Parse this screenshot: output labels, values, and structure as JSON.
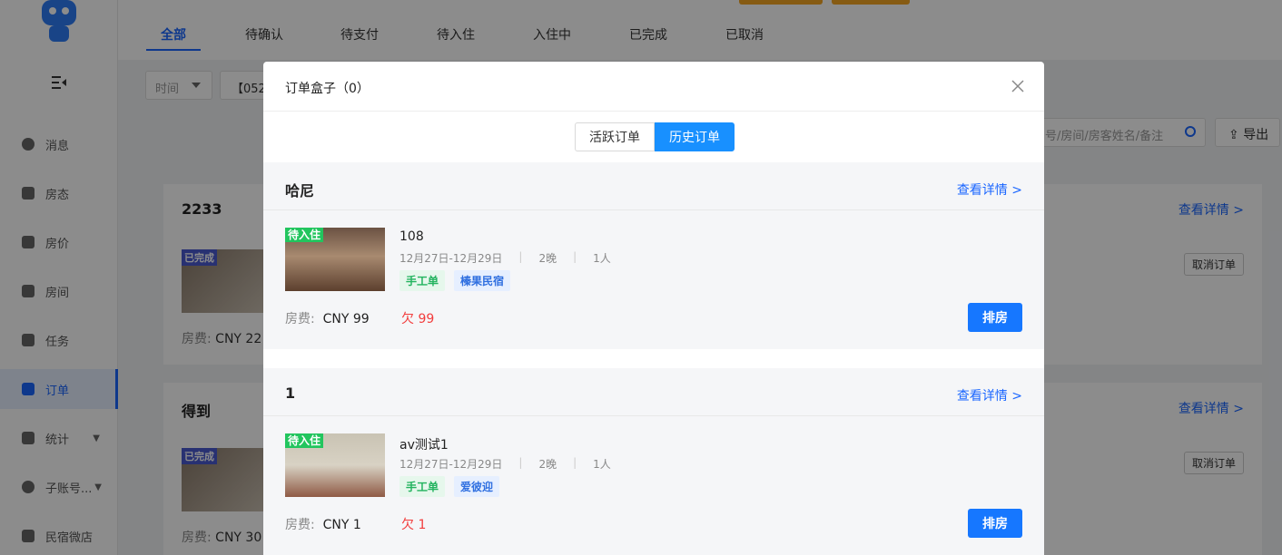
{
  "sidebar": {
    "items": [
      {
        "label": "消息",
        "icon": "message-icon"
      },
      {
        "label": "房态",
        "icon": "calendar-icon"
      },
      {
        "label": "房价",
        "icon": "price-icon"
      },
      {
        "label": "房间",
        "icon": "room-icon"
      },
      {
        "label": "任务",
        "icon": "task-icon"
      },
      {
        "label": "订单",
        "icon": "order-icon"
      },
      {
        "label": "统计",
        "icon": "stats-icon"
      },
      {
        "label": "子账号...",
        "icon": "users-icon"
      },
      {
        "label": "民宿微店",
        "icon": "shop-icon"
      }
    ]
  },
  "tabs": [
    "全部",
    "待确认",
    "待支付",
    "待入住",
    "入住中",
    "已完成",
    "已取消"
  ],
  "filters": {
    "time_label": "时间",
    "chip": "【052",
    "search_placeholder": "号/房间/房客姓名/备注",
    "export_label": "导出"
  },
  "bg_orders": [
    {
      "title": "2233",
      "detail": "查看详情 >",
      "badge": "已完成",
      "cancel": "取消订单",
      "fee_label": "房费:",
      "fee_value": "CNY 22"
    },
    {
      "title": "得到",
      "detail": "查看详情 >",
      "badge": "已完成",
      "cancel": "取消订单",
      "fee_label": "房费:",
      "fee_value": "CNY 30"
    }
  ],
  "modal": {
    "title": "订单盒子（0）",
    "seg": {
      "active_orders": "活跃订单",
      "history_orders": "历史订单"
    },
    "orders": [
      {
        "name": "哈尼",
        "detail": "查看详情 >",
        "badge": "待入住",
        "room": "108",
        "dates": "12月27日-12月29日",
        "nights": "2晚",
        "guests": "1人",
        "tags": [
          "手工单",
          "榛果民宿"
        ],
        "fee_label": "房费:",
        "fee_value": "CNY 99",
        "owe": "欠 99",
        "assign": "排房"
      },
      {
        "name": "1",
        "detail": "查看详情 >",
        "badge": "待入住",
        "room": "av测试1",
        "dates": "12月27日-12月29日",
        "nights": "2晚",
        "guests": "1人",
        "tags": [
          "手工单",
          "爱彼迎"
        ],
        "fee_label": "房费:",
        "fee_value": "CNY 1",
        "owe": "欠 1",
        "assign": "排房"
      }
    ]
  },
  "colors": {
    "accent": "#1677ff",
    "success": "#22c55e",
    "danger": "#f23c3c"
  }
}
